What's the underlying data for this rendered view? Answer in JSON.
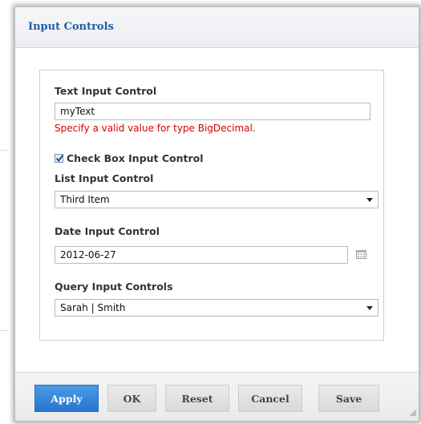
{
  "dialog": {
    "title": "Input Controls"
  },
  "controls": {
    "text_input": {
      "label": "Text Input Control",
      "value": "myText",
      "error": "Specify a valid value for type BigDecimal."
    },
    "checkbox": {
      "label": "Check Box Input Control",
      "checked": true
    },
    "list_input": {
      "label": "List Input Control",
      "value": "Third Item"
    },
    "date_input": {
      "label": "Date Input Control",
      "value": "2012-06-27",
      "icon": "calendar-icon"
    },
    "query_input": {
      "label": "Query Input Controls",
      "value": "Sarah | Smith"
    }
  },
  "footer": {
    "apply": "Apply",
    "ok": "OK",
    "reset": "Reset",
    "cancel": "Cancel",
    "save": "Save"
  },
  "colors": {
    "accent": "#2a74cf",
    "title": "#1f5ea8",
    "error": "#d40000"
  }
}
